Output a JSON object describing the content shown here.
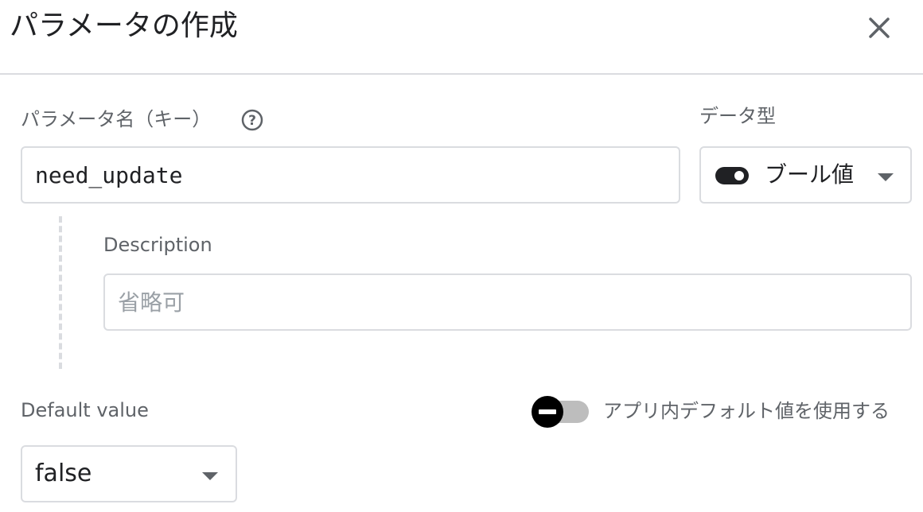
{
  "dialog": {
    "title": "パラメータの作成",
    "close_icon": "close-icon"
  },
  "param_key": {
    "label": "パラメータ名（キー）",
    "help_icon": "help-circle-icon",
    "value": "need_update"
  },
  "data_type": {
    "label": "データ型",
    "selected": "ブール値",
    "icon": "toggle-icon"
  },
  "description": {
    "label": "Description",
    "placeholder": "省略可",
    "value": ""
  },
  "default_value": {
    "label": "Default value",
    "selected": "false"
  },
  "in_app_default": {
    "label": "アプリ内デフォルト値を使用する",
    "enabled": false
  },
  "colors": {
    "border": "#dadce0",
    "label_text": "#5f6368",
    "primary_text": "#202124",
    "placeholder": "#9aa0a6",
    "toggle_track": "#bdbdbd",
    "toggle_knob": "#000000"
  }
}
